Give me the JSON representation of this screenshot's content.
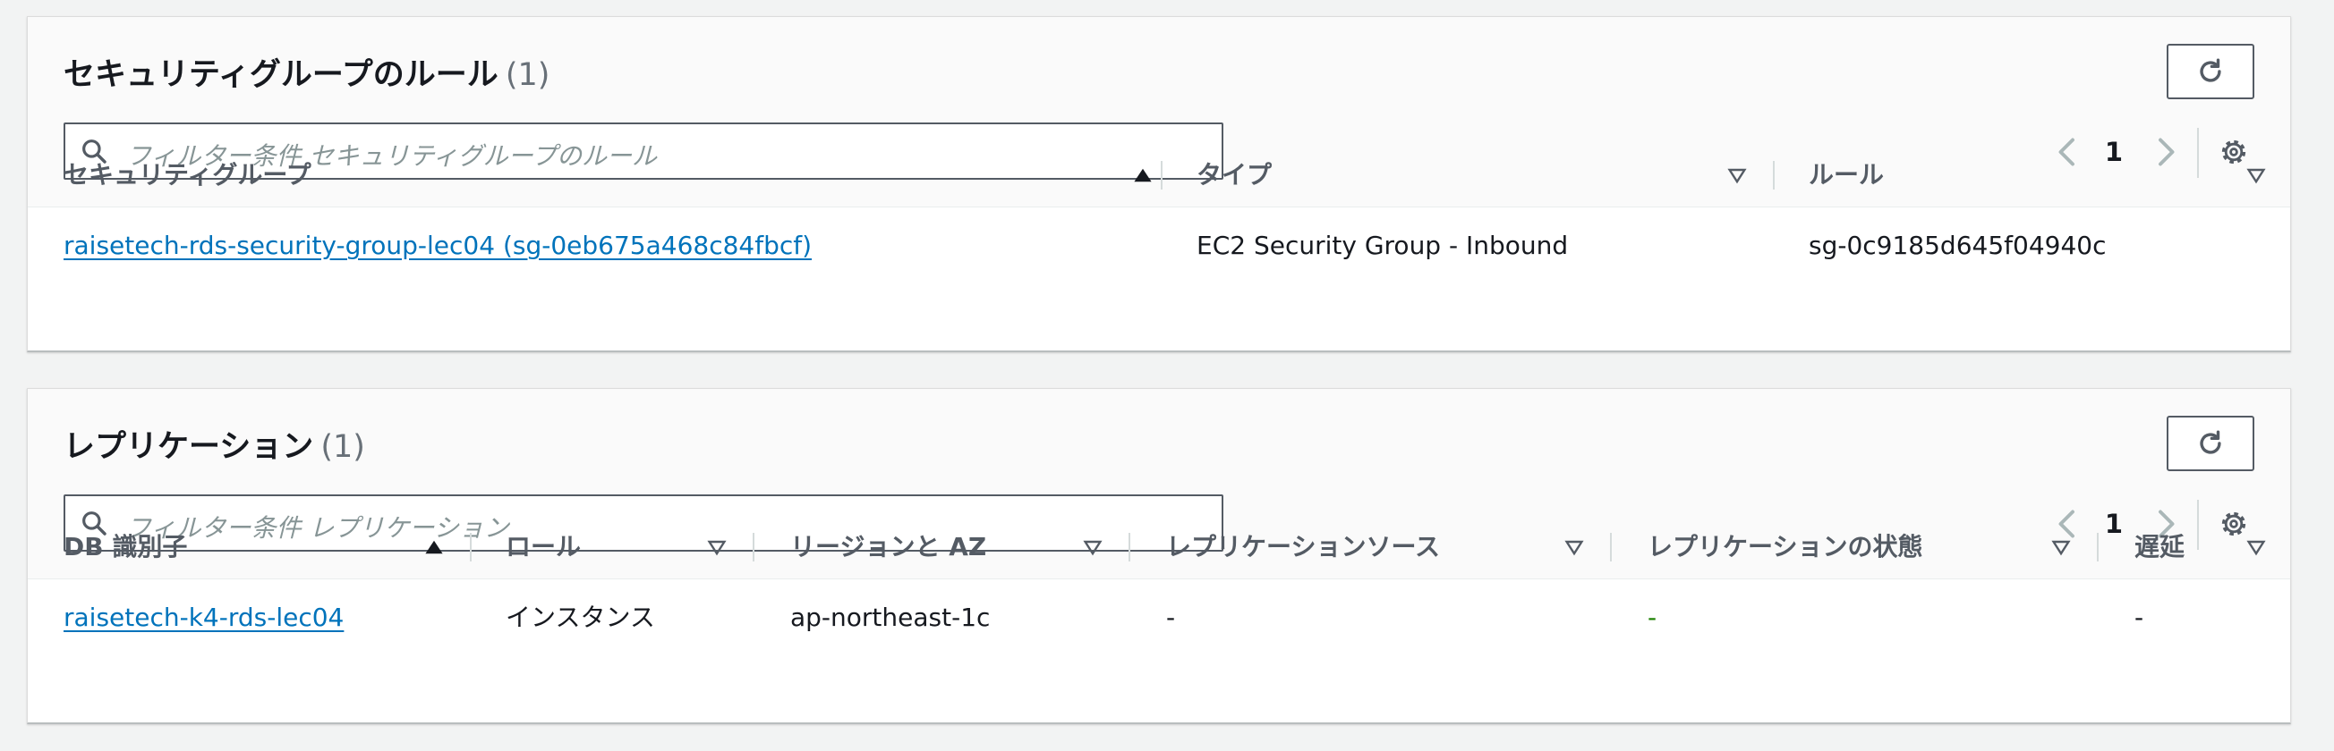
{
  "security_group_rules": {
    "title": "セキュリティグループのルール",
    "count": "(1)",
    "search_placeholder": "フィルター条件 セキュリティグループのルール",
    "page": "1",
    "columns": [
      "セキュリティグループ",
      "タイプ",
      "ルール"
    ],
    "rows": [
      {
        "security_group": "raisetech-rds-security-group-lec04 (sg-0eb675a468c84fbcf)",
        "type": "EC2 Security Group - Inbound",
        "rule": "sg-0c9185d645f04940c"
      }
    ]
  },
  "replication": {
    "title": "レプリケーション",
    "count": "(1)",
    "search_placeholder": "フィルター条件 レプリケーション",
    "page": "1",
    "columns": [
      "DB 識別子",
      "ロール",
      "リージョンと AZ",
      "レプリケーションソース",
      "レプリケーションの状態",
      "遅延"
    ],
    "rows": [
      {
        "db_identifier": "raisetech-k4-rds-lec04",
        "role": "インスタンス",
        "region_az": "ap-northeast-1c",
        "source": "-",
        "status": "-",
        "lag": "-"
      }
    ]
  },
  "icons": {
    "refresh": "refresh-icon",
    "search": "search-icon",
    "prev": "chevron-left-icon",
    "next": "chevron-right-icon",
    "settings": "gear-icon",
    "sort_asc": "sort-ascending-icon",
    "sort_none": "sort-unsorted-icon"
  },
  "colors": {
    "link": "#0073bb",
    "status_dash": "#1d8102",
    "header_bg": "#fafafa",
    "page_bg": "#f2f3f3"
  }
}
